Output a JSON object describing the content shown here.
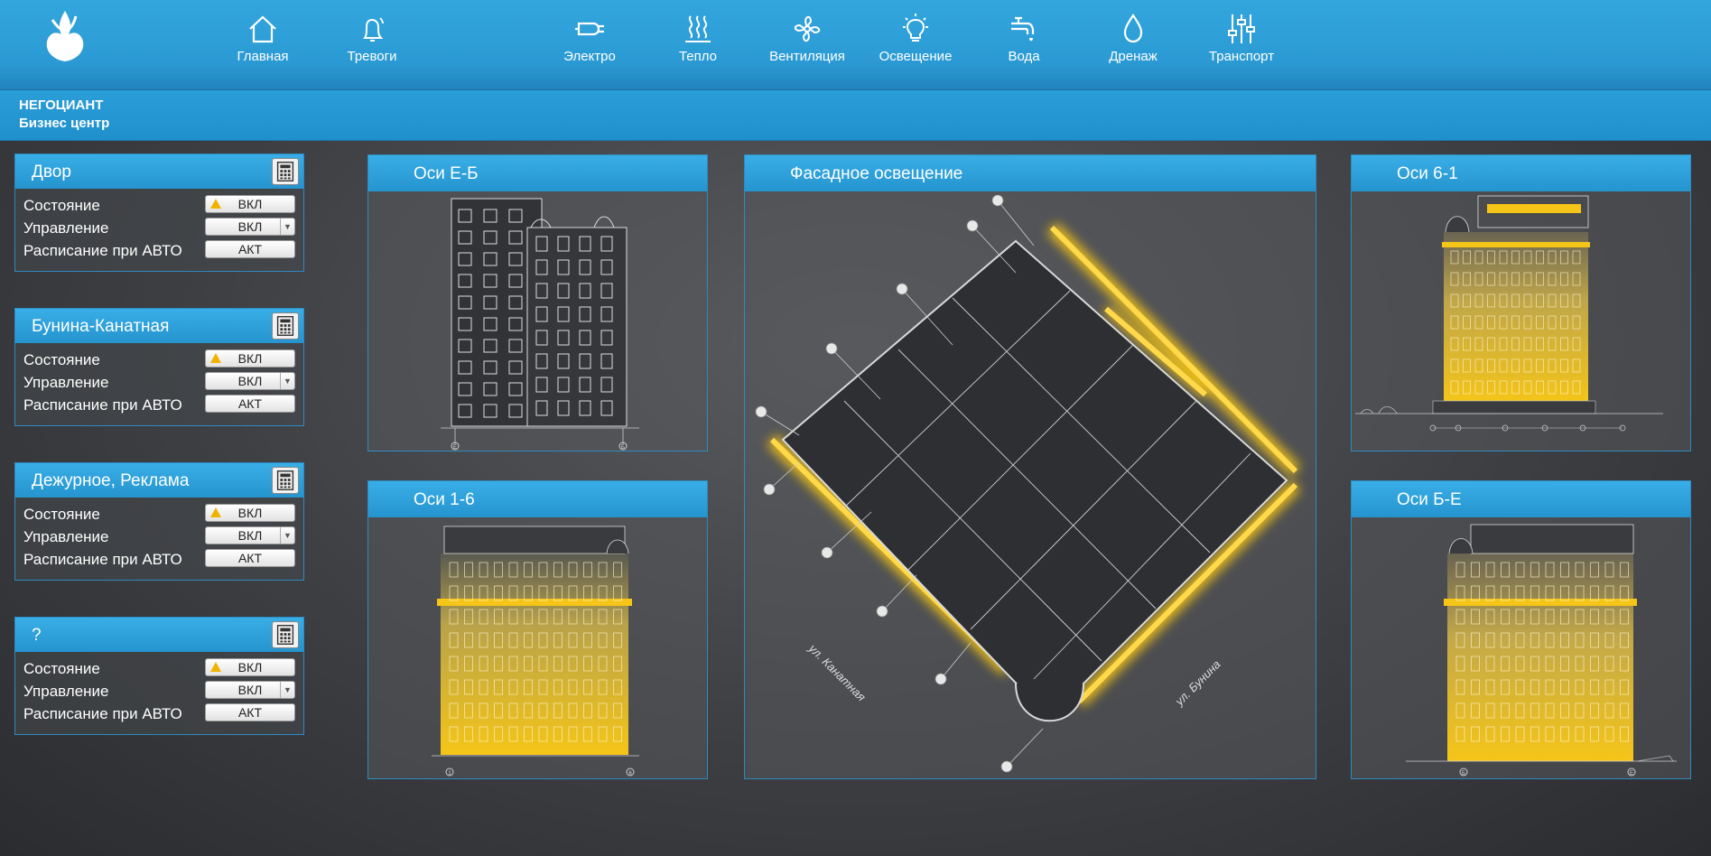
{
  "nav": [
    {
      "key": "home",
      "label": "Главная",
      "icon": "home-icon"
    },
    {
      "key": "alarms",
      "label": "Тревоги",
      "icon": "bell-icon"
    },
    {
      "key": "electro",
      "label": "Электро",
      "icon": "plug-icon"
    },
    {
      "key": "heat",
      "label": "Тепло",
      "icon": "heat-icon"
    },
    {
      "key": "vent",
      "label": "Вентиляция",
      "icon": "fan-icon"
    },
    {
      "key": "light",
      "label": "Освещение",
      "icon": "bulb-icon"
    },
    {
      "key": "water",
      "label": "Вода",
      "icon": "faucet-icon"
    },
    {
      "key": "drain",
      "label": "Дренаж",
      "icon": "drop-icon"
    },
    {
      "key": "transport",
      "label": "Транспорт",
      "icon": "sliders-icon"
    }
  ],
  "info": {
    "company": "НЕГОЦИАНТ",
    "subtitle": "Бизнес центр"
  },
  "controls": [
    {
      "title": "Двор",
      "state": "ВКЛ",
      "mode": "ВКЛ",
      "schedule": "АКТ"
    },
    {
      "title": "Бунина-Канатная",
      "state": "ВКЛ",
      "mode": "ВКЛ",
      "schedule": "АКТ"
    },
    {
      "title": "Дежурное, Реклама",
      "state": "ВКЛ",
      "mode": "ВКЛ",
      "schedule": "АКТ"
    },
    {
      "title": "?",
      "state": "ВКЛ",
      "mode": "ВКЛ",
      "schedule": "АКТ"
    }
  ],
  "labels": {
    "state": "Состояние",
    "mode": "Управление",
    "schedule": "Расписание при АВТО"
  },
  "panels": {
    "e_b": "Оси Е-Б",
    "p1_6": "Оси 1-6",
    "facade": "Фасадное освещение",
    "p6_1": "Оси 6-1",
    "b_e": "Оси Б-Е"
  },
  "streets": {
    "left": "ул. Канатная",
    "right": "ул. Бунина"
  },
  "axis_marks": {
    "e_b": [
      "Е",
      "Б"
    ],
    "p1_6": [
      "1",
      "6"
    ],
    "b_e": [
      "Б",
      "Е"
    ]
  },
  "colors": {
    "accent": "#2a9ed8",
    "light_yellow": "#f5c518",
    "warning": "#f0b400"
  }
}
